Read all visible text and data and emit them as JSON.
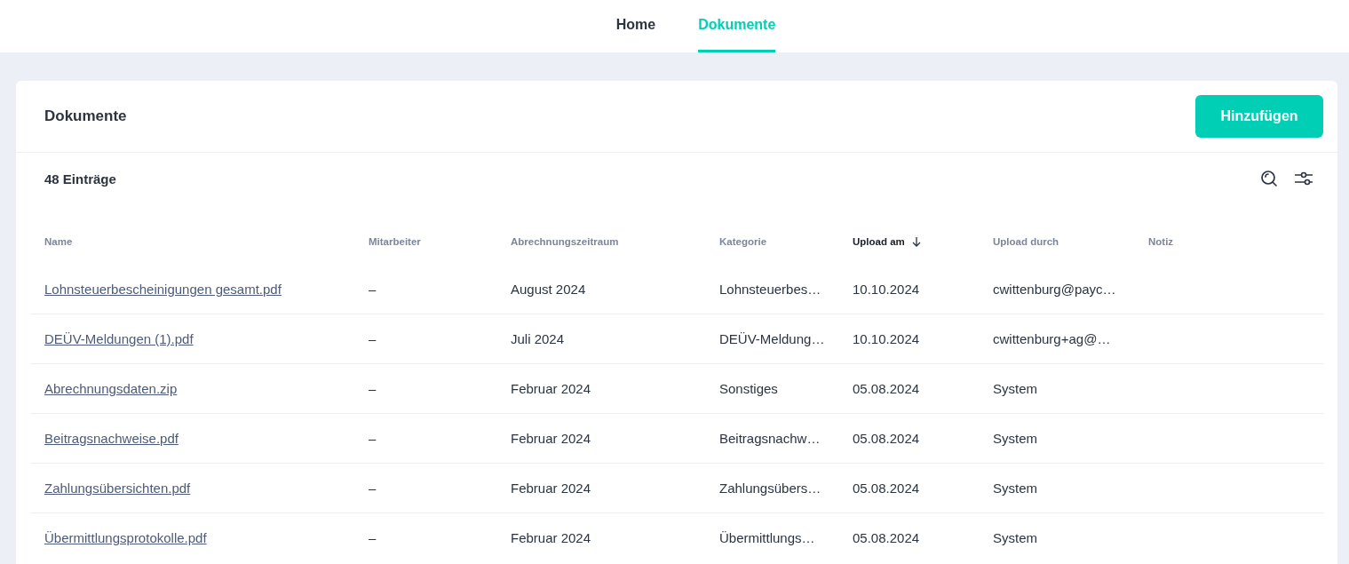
{
  "nav": {
    "tabs": [
      {
        "label": "Home",
        "selected": false
      },
      {
        "label": "Dokumente",
        "selected": true
      }
    ]
  },
  "card": {
    "title": "Dokumente",
    "add_button": "Hinzufügen",
    "count": "48 Einträge"
  },
  "table": {
    "columns": [
      {
        "label": "Name",
        "sorted": false
      },
      {
        "label": "Mitarbeiter",
        "sorted": false
      },
      {
        "label": "Abrechnungszeitraum",
        "sorted": false
      },
      {
        "label": "Kategorie",
        "sorted": false
      },
      {
        "label": "Upload am",
        "sorted": true
      },
      {
        "label": "Upload durch",
        "sorted": false
      },
      {
        "label": "Notiz",
        "sorted": false
      }
    ],
    "rows": [
      [
        "Lohnsteuerbescheinigungen gesamt.pdf",
        "–",
        "August 2024",
        "Lohnsteuerbes…",
        "10.10.2024",
        "cwittenburg@payc…"
      ],
      [
        "DEÜV-Meldungen (1).pdf",
        "–",
        "Juli 2024",
        "DEÜV-Meldung…",
        "10.10.2024",
        "cwittenburg+ag@…"
      ],
      [
        "Abrechnungsdaten.zip",
        "–",
        "Februar 2024",
        "Sonstiges",
        "05.08.2024",
        "System"
      ],
      [
        "Beitragsnachweise.pdf",
        "–",
        "Februar 2024",
        "Beitragsnachw…",
        "05.08.2024",
        "System"
      ],
      [
        "Zahlungsübersichten.pdf",
        "–",
        "Februar 2024",
        "Zahlungsübers…",
        "05.08.2024",
        "System"
      ],
      [
        "Übermittlungsprotokolle.pdf",
        "–",
        "Februar 2024",
        "Übermittlungs…",
        "05.08.2024",
        "System"
      ]
    ]
  }
}
